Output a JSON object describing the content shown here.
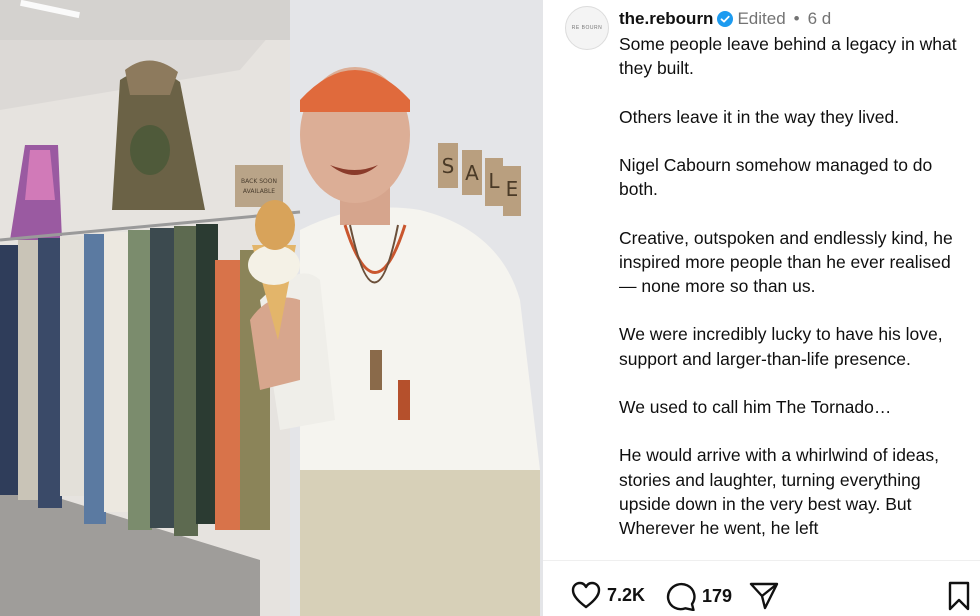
{
  "post": {
    "username": "the.rebourn",
    "avatar_text": "RE BOURN",
    "edited": "Edited",
    "separator": "•",
    "age": "6 d",
    "caption": [
      "Some people leave behind a legacy in what they built.",
      "Others leave it in the way they lived.",
      "Nigel Cabourn somehow managed to do both.",
      "Creative, outspoken and endlessly kind, he inspired more people than he ever realised — none more so than us.",
      "We were incredibly lucky to have his love, support and larger-than-life presence.",
      "We used to call him The Tornado…",
      "He would arrive with a whirlwind of ideas, stories and laughter, turning everything upside down in the very best way. But Wherever he went, he left"
    ]
  },
  "photo": {
    "sign_letters": [
      "S",
      "A",
      "L",
      "E"
    ],
    "small_sign": "BACK SOON AVAILABLE"
  },
  "actions": {
    "likes": "7.2K",
    "comments": "179"
  },
  "icons": {
    "like": "heart-icon",
    "comment": "comment-icon",
    "share": "send-icon",
    "save": "bookmark-icon",
    "verified": "verified-badge-icon"
  },
  "colors": {
    "verified_blue": "#1d9bf0",
    "text": "#0f0f0f",
    "muted": "#737373"
  }
}
